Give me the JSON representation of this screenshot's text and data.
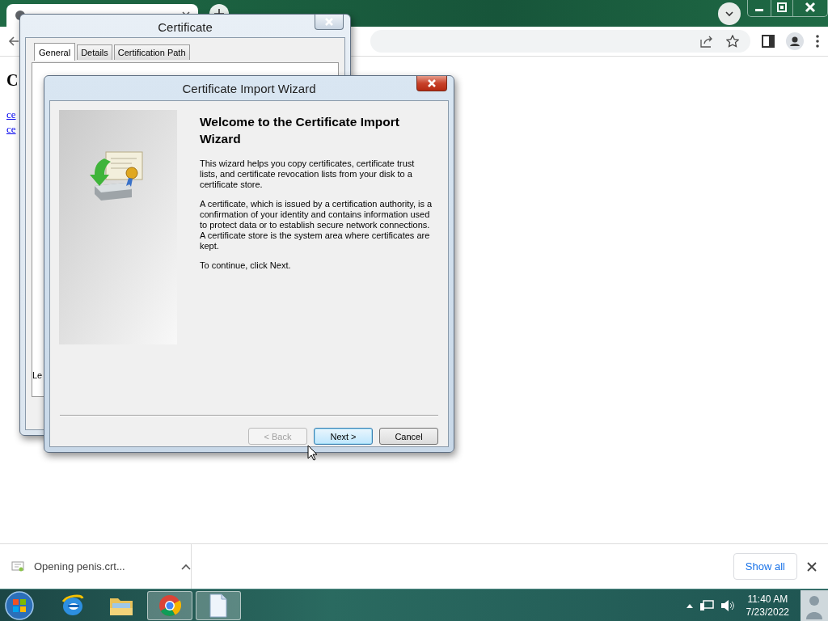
{
  "page": {
    "heading": "C",
    "links": [
      "ce",
      "ce"
    ]
  },
  "certificate_dialog": {
    "title": "Certificate",
    "tabs": [
      {
        "label": "General",
        "selected": true
      },
      {
        "label": "Details",
        "selected": false
      },
      {
        "label": "Certification Path",
        "selected": false
      }
    ],
    "partial_text": "Le"
  },
  "wizard": {
    "title": "Certificate Import Wizard",
    "heading": "Welcome to the Certificate Import Wizard",
    "paragraphs": [
      "This wizard helps you copy certificates, certificate trust lists, and certificate revocation lists from your disk to a certificate store.",
      "A certificate, which is issued by a certification authority, is a confirmation of your identity and contains information used to protect data or to establish secure network connections. A certificate store is the system area where certificates are kept.",
      "To continue, click Next."
    ],
    "buttons": [
      {
        "label": "< Back",
        "disabled": true,
        "default": false
      },
      {
        "label": "Next >",
        "disabled": false,
        "default": true
      },
      {
        "label": "Cancel",
        "disabled": false,
        "default": false
      }
    ]
  },
  "download_bar": {
    "item": "Opening penis.crt...",
    "show_all": "Show all"
  },
  "taskbar": {
    "apps": [
      {
        "kind": "ie",
        "active": false
      },
      {
        "kind": "explorer",
        "active": false
      },
      {
        "kind": "chrome",
        "active": true
      },
      {
        "kind": "document",
        "active": true
      }
    ],
    "time": "11:40 AM",
    "date": "7/23/2022"
  }
}
